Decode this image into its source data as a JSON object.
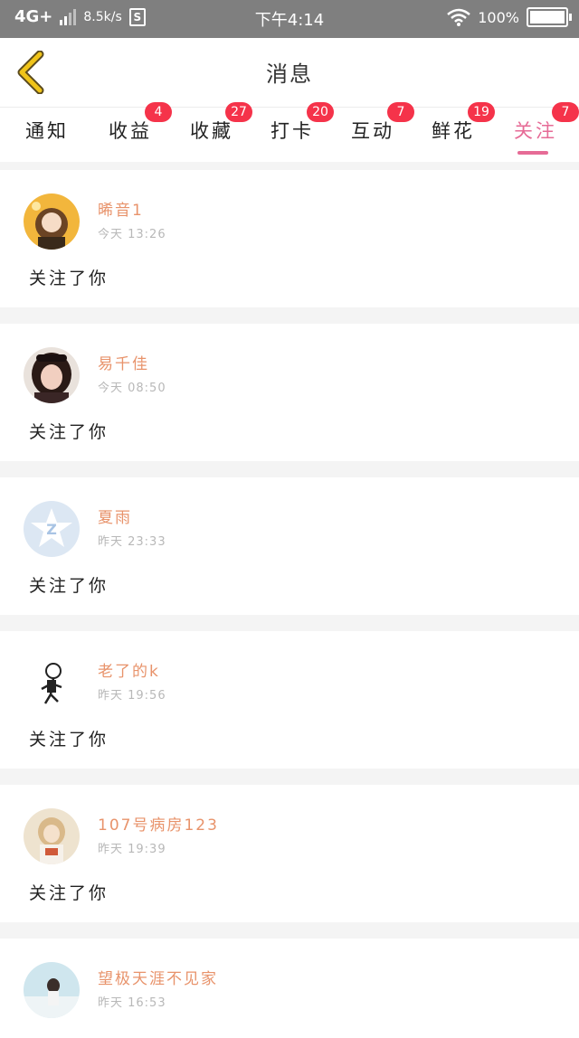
{
  "status_bar": {
    "network": "4G+",
    "speed": "8.5k/s",
    "sim_label": "S",
    "time": "下午4:14",
    "battery": "100%"
  },
  "header": {
    "title": "消息"
  },
  "tabs": [
    {
      "label": "通知",
      "badge": ""
    },
    {
      "label": "收益",
      "badge": "4"
    },
    {
      "label": "收藏",
      "badge": "27"
    },
    {
      "label": "打卡",
      "badge": "20"
    },
    {
      "label": "互动",
      "badge": "7"
    },
    {
      "label": "鲜花",
      "badge": "19"
    },
    {
      "label": "关注",
      "badge": "7"
    }
  ],
  "messages": [
    {
      "username": "晞音1",
      "time": "今天 13:26",
      "action": "关注了你"
    },
    {
      "username": "易千佳",
      "time": "今天 08:50",
      "action": "关注了你"
    },
    {
      "username": "夏雨",
      "time": "昨天 23:33",
      "action": "关注了你"
    },
    {
      "username": "老了的k",
      "time": "昨天 19:56",
      "action": "关注了你"
    },
    {
      "username": "107号病房123",
      "time": "昨天 19:39",
      "action": "关注了你"
    },
    {
      "username": "望极天涯不见家",
      "time": "昨天 16:53",
      "action": ""
    }
  ],
  "colors": {
    "accent": "#e66b96",
    "username": "#e8936b",
    "badge": "#f5334a",
    "back_arrow": "#f0c419"
  }
}
